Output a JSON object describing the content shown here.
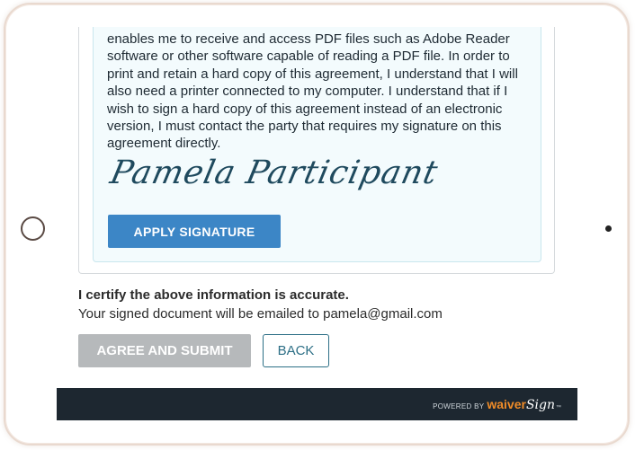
{
  "consent": {
    "text": "enables me to receive and access PDF files such as Adobe Reader software or other software capable of reading a PDF file. In order to print and retain a hard copy of this agreement, I understand that I will also need a printer connected to my computer. I understand that if I wish to sign a hard copy of this agreement instead of an electronic version, I must contact the party that requires my signature on this agreement directly."
  },
  "signature": {
    "name": "Pamela Participant",
    "apply_label": "APPLY SIGNATURE"
  },
  "certification": {
    "heading": "I certify the above information is accurate.",
    "email_note": "Your signed document will be emailed to pamela@gmail.com"
  },
  "actions": {
    "agree_label": "AGREE AND SUBMIT",
    "back_label": "BACK"
  },
  "footer": {
    "powered_by": "POWERED BY",
    "brand_part1": "waiver",
    "brand_part2": "Sign",
    "brand_tm": "™"
  },
  "colors": {
    "primary_button": "#3c86c6",
    "disabled_button": "#b6b9bb",
    "footer_bg": "#1d2730",
    "brand_orange": "#f08c28",
    "panel_bg": "#f3fbfd"
  }
}
